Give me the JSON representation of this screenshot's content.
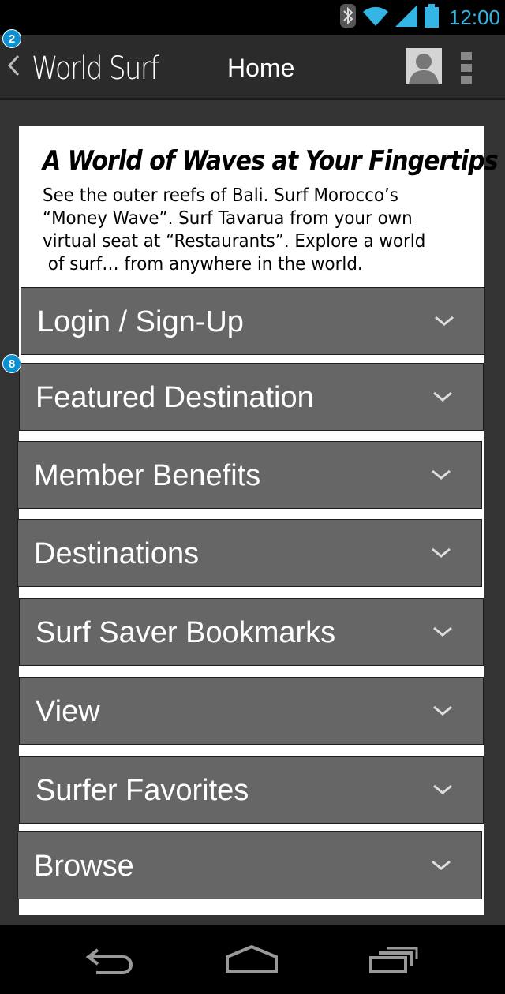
{
  "status_bar": {
    "time": "12:00",
    "icons": [
      "bluetooth-icon",
      "wifi-icon",
      "signal-icon",
      "battery-icon"
    ],
    "accent_color": "#33b5e5"
  },
  "action_bar": {
    "app_title": "World Surf",
    "page_title": "Home",
    "icons": [
      "back-chevron-icon",
      "avatar-icon",
      "overflow-menu-icon"
    ]
  },
  "annotations": {
    "badge_top": "2",
    "badge_accordion": "8"
  },
  "hero": {
    "title": "A World of Waves at Your Fingertips",
    "lines": [
      "See the outer reefs of Bali. Surf Morocco’s",
      "“Money Wave”. Surf Tavarua from your own",
      "virtual seat at “Restaurants”. Explore a world",
      " of surf… from anywhere in the world."
    ]
  },
  "accordion": [
    {
      "label": "Login / Sign-Up"
    },
    {
      "label": "Featured Destination"
    },
    {
      "label": "Member Benefits"
    },
    {
      "label": "Destinations"
    },
    {
      "label": "Surf Saver Bookmarks"
    },
    {
      "label": "View"
    },
    {
      "label": "Surfer Favorites"
    },
    {
      "label": "Browse"
    }
  ],
  "nav_bar": {
    "icons": [
      "back-icon",
      "home-icon",
      "recent-apps-icon"
    ]
  }
}
